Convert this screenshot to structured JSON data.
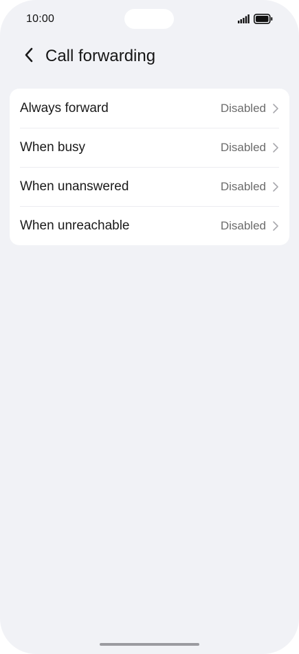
{
  "status_bar": {
    "time": "10:00",
    "icons": [
      "signal-icon",
      "battery-icon"
    ]
  },
  "header": {
    "title": "Call forwarding",
    "back_icon": "chevron-left-icon"
  },
  "settings": [
    {
      "label": "Always forward",
      "value": "Disabled"
    },
    {
      "label": "When busy",
      "value": "Disabled"
    },
    {
      "label": "When unanswered",
      "value": "Disabled"
    },
    {
      "label": "When unreachable",
      "value": "Disabled"
    }
  ],
  "colors": {
    "background": "#f1f2f6",
    "card": "#ffffff",
    "text_primary": "#1a1a1a",
    "text_secondary": "#6b6b6b"
  }
}
